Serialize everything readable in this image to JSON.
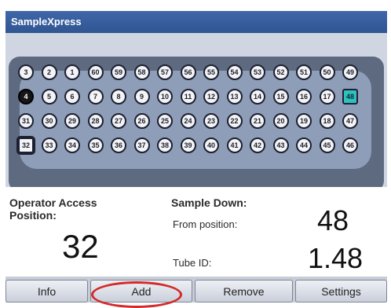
{
  "app": {
    "title": "SampleXpress"
  },
  "carousel": {
    "row1": [
      "3",
      "2",
      "1",
      "60",
      "59",
      "58",
      "57",
      "56",
      "55",
      "54",
      "53",
      "52",
      "51",
      "50",
      "49"
    ],
    "row2": [
      "4",
      "5",
      "6",
      "7",
      "8",
      "9",
      "10",
      "11",
      "12",
      "13",
      "14",
      "15",
      "16",
      "17",
      "48"
    ],
    "row3": [
      "31",
      "30",
      "29",
      "28",
      "27",
      "26",
      "25",
      "24",
      "23",
      "22",
      "21",
      "20",
      "19",
      "18",
      "47"
    ],
    "row4": [
      "32",
      "33",
      "34",
      "35",
      "36",
      "37",
      "38",
      "39",
      "40",
      "41",
      "42",
      "43",
      "44",
      "45",
      "46"
    ],
    "highlight": {
      "dark": "4",
      "teal": "48",
      "square": "32"
    }
  },
  "operator_access": {
    "label": "Operator Access\nPosition:",
    "value": "32"
  },
  "sample_down": {
    "label": "Sample Down:",
    "from_label": "From position:",
    "from_value": "48",
    "tube_label": "Tube ID:",
    "tube_value": "1.48"
  },
  "buttons": {
    "info": "Info",
    "add": "Add",
    "remove": "Remove",
    "settings": "Settings"
  }
}
